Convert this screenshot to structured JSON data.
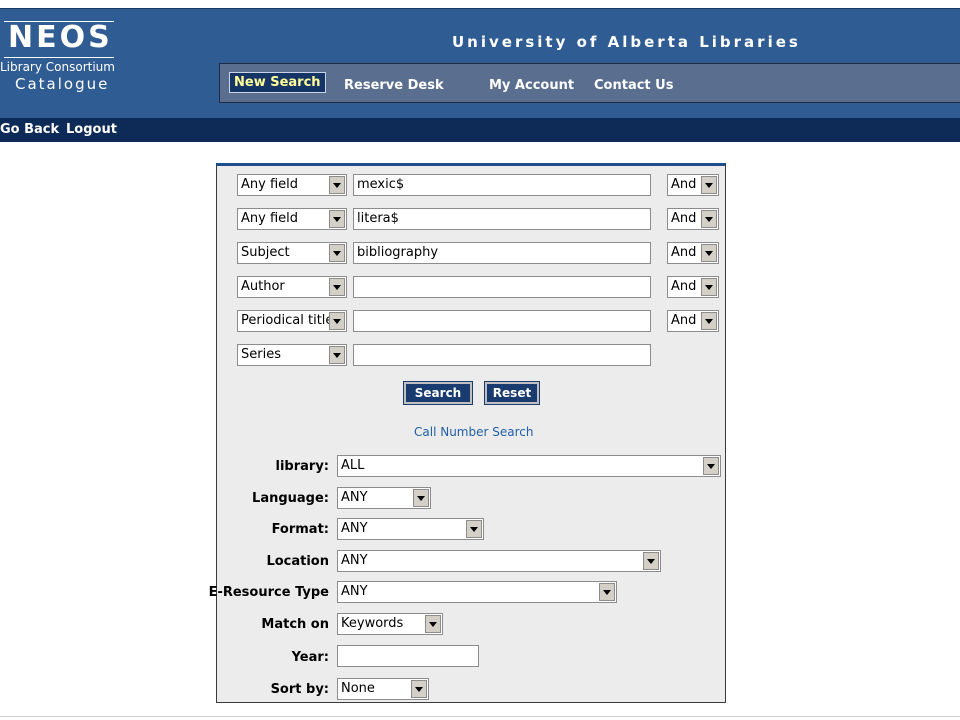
{
  "header": {
    "logo_title": "NEOS",
    "logo_subtitle": "Library Consortium",
    "logo_catalogue": "Catalogue",
    "university": "University of Alberta Libraries"
  },
  "nav": {
    "new_search": "New Search",
    "reserve_desk": "Reserve Desk",
    "my_account": "My Account",
    "contact_us": "Contact Us"
  },
  "subnav": {
    "go_back": "Go Back",
    "logout": "Logout"
  },
  "search_rows": [
    {
      "field": "Any field",
      "term": "mexic$",
      "operator": "And"
    },
    {
      "field": "Any field",
      "term": "litera$",
      "operator": "And"
    },
    {
      "field": "Subject",
      "term": "bibliography",
      "operator": "And"
    },
    {
      "field": "Author",
      "term": "",
      "operator": "And"
    },
    {
      "field": "Periodical title",
      "term": "",
      "operator": "And"
    },
    {
      "field": "Series",
      "term": ""
    }
  ],
  "buttons": {
    "search": "Search",
    "reset": "Reset"
  },
  "call_number_link": "Call Number Search",
  "filters": {
    "library": {
      "label": "library:",
      "value": "ALL"
    },
    "language": {
      "label": "Language:",
      "value": "ANY"
    },
    "format": {
      "label": "Format:",
      "value": "ANY"
    },
    "location": {
      "label": "Location",
      "value": "ANY"
    },
    "eresource": {
      "label": "E-Resource Type",
      "value": "ANY"
    },
    "match_on": {
      "label": "Match on",
      "value": "Keywords"
    },
    "year": {
      "label": "Year:",
      "value": ""
    },
    "sort_by": {
      "label": "Sort by:",
      "value": "None"
    }
  }
}
